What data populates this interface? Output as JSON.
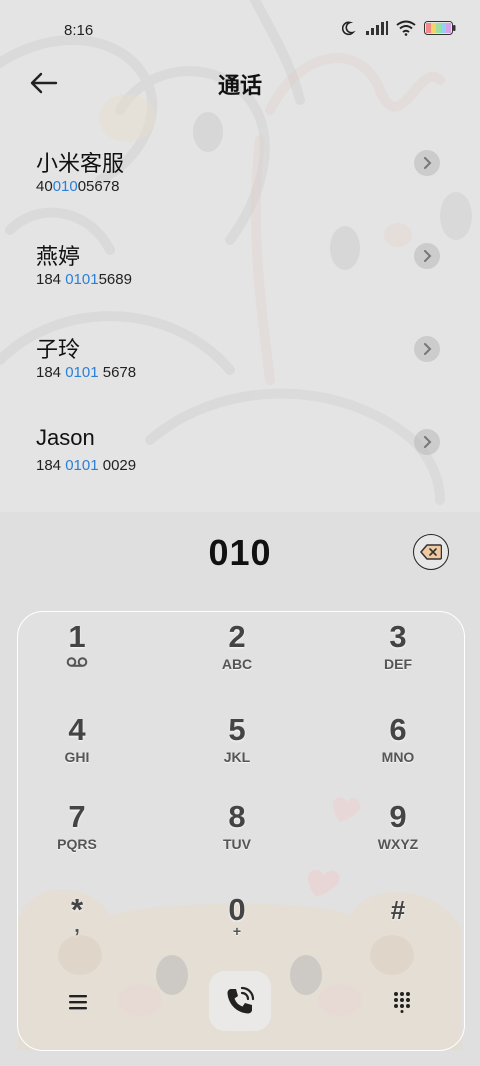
{
  "status_bar": {
    "time": "8:16",
    "icons": [
      "moon-icon",
      "signal-icon",
      "wifi-icon",
      "battery-icon"
    ]
  },
  "header": {
    "title": "通话",
    "back_icon": "back-arrow-icon"
  },
  "contacts": [
    {
      "name": "小米客服",
      "number_pre": "40",
      "number_match": "010",
      "number_post": "05678"
    },
    {
      "name": "燕婷",
      "number_pre": "184 ",
      "number_match": "0101",
      "number_post": "5689"
    },
    {
      "name": "子玲",
      "number_pre": "184 ",
      "number_match": "0101",
      "number_post": " 5678"
    },
    {
      "name": "Jason",
      "number_pre": "184 ",
      "number_match": "0101",
      "number_post": " 0029"
    }
  ],
  "dialer": {
    "typed_number": "010",
    "backspace_icon": "backspace-icon"
  },
  "keypad": {
    "keys": [
      {
        "digit": "1",
        "letters": ""
      },
      {
        "digit": "2",
        "letters": "ABC"
      },
      {
        "digit": "3",
        "letters": "DEF"
      },
      {
        "digit": "4",
        "letters": "GHI"
      },
      {
        "digit": "5",
        "letters": "JKL"
      },
      {
        "digit": "6",
        "letters": "MNO"
      },
      {
        "digit": "7",
        "letters": "PQRS"
      },
      {
        "digit": "8",
        "letters": "TUV"
      },
      {
        "digit": "9",
        "letters": "WXYZ"
      },
      {
        "digit": "*",
        "letters": ","
      },
      {
        "digit": "0",
        "letters": "+"
      },
      {
        "digit": "#",
        "letters": ""
      }
    ]
  },
  "bottom_bar": {
    "menu_icon": "menu-icon",
    "call_icon": "phone-call-icon",
    "dialpad_icon": "dialpad-icon"
  },
  "colors": {
    "highlight": "#2a7fd8",
    "text": "#111111"
  }
}
